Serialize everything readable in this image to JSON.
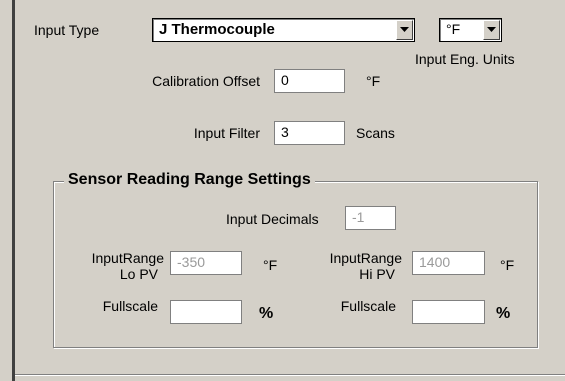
{
  "input_type": {
    "label": "Input Type",
    "value": "J Thermocouple"
  },
  "eng_units": {
    "value": "°F",
    "label": "Input Eng. Units"
  },
  "calibration_offset": {
    "label": "Calibration Offset",
    "value": "0",
    "unit": "°F"
  },
  "input_filter": {
    "label": "Input Filter",
    "value": "3",
    "unit": "Scans"
  },
  "sensor_range": {
    "title": "Sensor Reading Range Settings",
    "input_decimals": {
      "label": "Input Decimals",
      "value": "-1"
    },
    "range_lo": {
      "label_line1": "InputRange",
      "label_line2": "Lo PV",
      "value": "-350",
      "unit": "°F"
    },
    "range_hi": {
      "label_line1": "InputRange",
      "label_line2": "Hi PV",
      "value": "1400",
      "unit": "°F"
    },
    "fullscale_left": {
      "label": "Fullscale",
      "value": "",
      "unit": "%"
    },
    "fullscale_right": {
      "label": "Fullscale",
      "value": "",
      "unit": "%"
    }
  }
}
